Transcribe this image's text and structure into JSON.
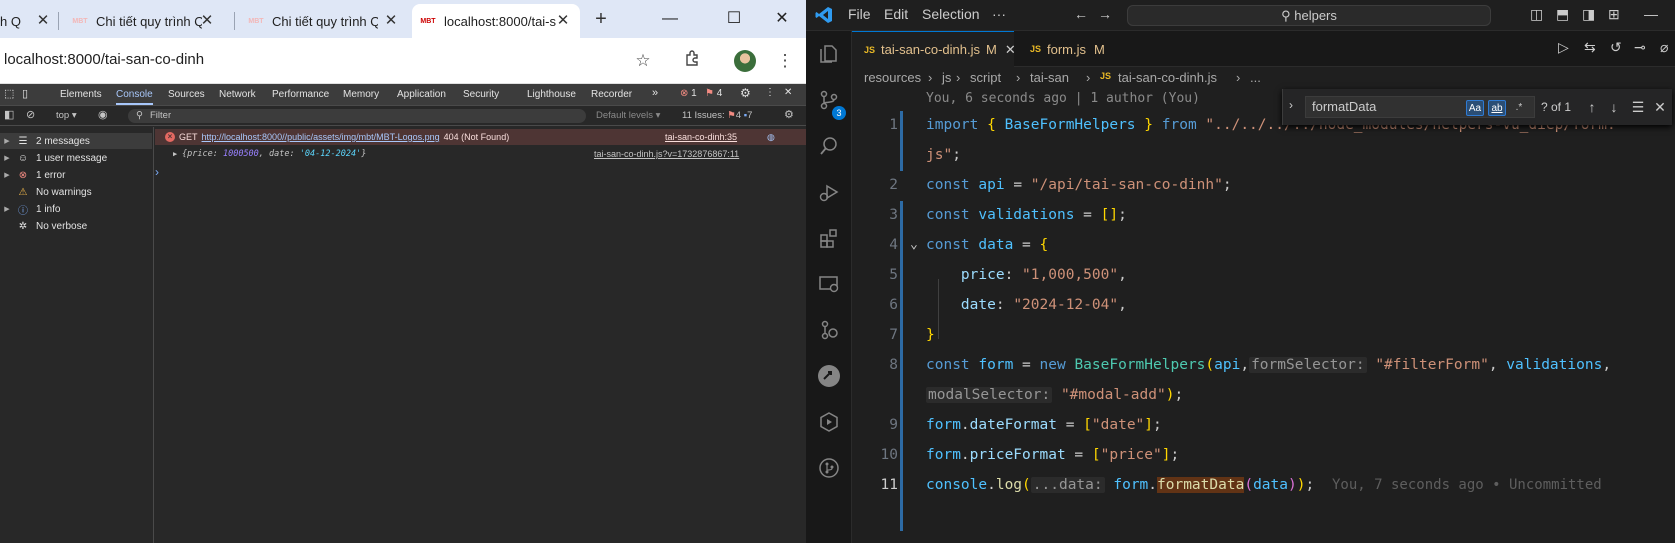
{
  "browser": {
    "tabs": [
      {
        "title": "h Q",
        "favicon": ""
      },
      {
        "title": "Chi tiết quy trình Q",
        "favicon": "MBT"
      },
      {
        "title": "Chi tiết quy trình Q",
        "favicon": "MBT"
      },
      {
        "title": "localhost:8000/tai-s",
        "favicon": "MBT"
      }
    ],
    "url": "localhost:8000/tai-san-co-dinh"
  },
  "devtools": {
    "tabs": [
      "Elements",
      "Console",
      "Sources",
      "Network",
      "Performance",
      "Memory",
      "Application",
      "Security",
      "Lighthouse",
      "Recorder"
    ],
    "error_count": "1",
    "warn_count": "4",
    "context": "top",
    "filter_placeholder": "Filter",
    "default_levels": "Default levels",
    "issues_label": "11 Issues:",
    "issues_err": "4",
    "issues_info": "7",
    "sidebar": [
      {
        "label": "2 messages",
        "icon": "list-icon"
      },
      {
        "label": "1 user message",
        "icon": "user-icon"
      },
      {
        "label": "1 error",
        "icon": "error-icon"
      },
      {
        "label": "No warnings",
        "icon": "warning-icon"
      },
      {
        "label": "1 info",
        "icon": "info-icon"
      },
      {
        "label": "No verbose",
        "icon": "bug-icon"
      }
    ],
    "console": {
      "error_method": "GET",
      "error_url": "http://localhost:8000//public/assets/img/mbt/MBT-Logos.png",
      "error_status": "404 (Not Found)",
      "error_source": "tai-san-co-dinh:35",
      "log_price_key": "price:",
      "log_price_val": "1000500",
      "log_date_key": "date:",
      "log_date_val": "'04-12-2024'",
      "log_source": "tai-san-co-dinh.js?v=1732876867:11",
      "prompt": "›"
    }
  },
  "vscode": {
    "menu": [
      "File",
      "Edit",
      "Selection",
      "···"
    ],
    "search": "helpers",
    "scm_badge": "3",
    "editor_tabs": [
      {
        "name": "tai-san-co-dinh.js",
        "status": "M"
      },
      {
        "name": "form.js",
        "status": "M"
      }
    ],
    "breadcrumbs": [
      "resources",
      "js",
      "script",
      "tai-san",
      "tai-san-co-dinh.js",
      "..."
    ],
    "blame_header": "You, 6 seconds ago | 1 author (You)",
    "find": {
      "query": "formatData",
      "case_opt": "Aa",
      "word_opt": "ab",
      "regex_opt": ".*",
      "result": "? of 1"
    },
    "line_numbers": [
      "1",
      "2",
      "3",
      "4",
      "5",
      "6",
      "7",
      "8",
      "9",
      "10",
      "11"
    ],
    "inline_blame": "You, 7 seconds ago • Uncommitted"
  }
}
